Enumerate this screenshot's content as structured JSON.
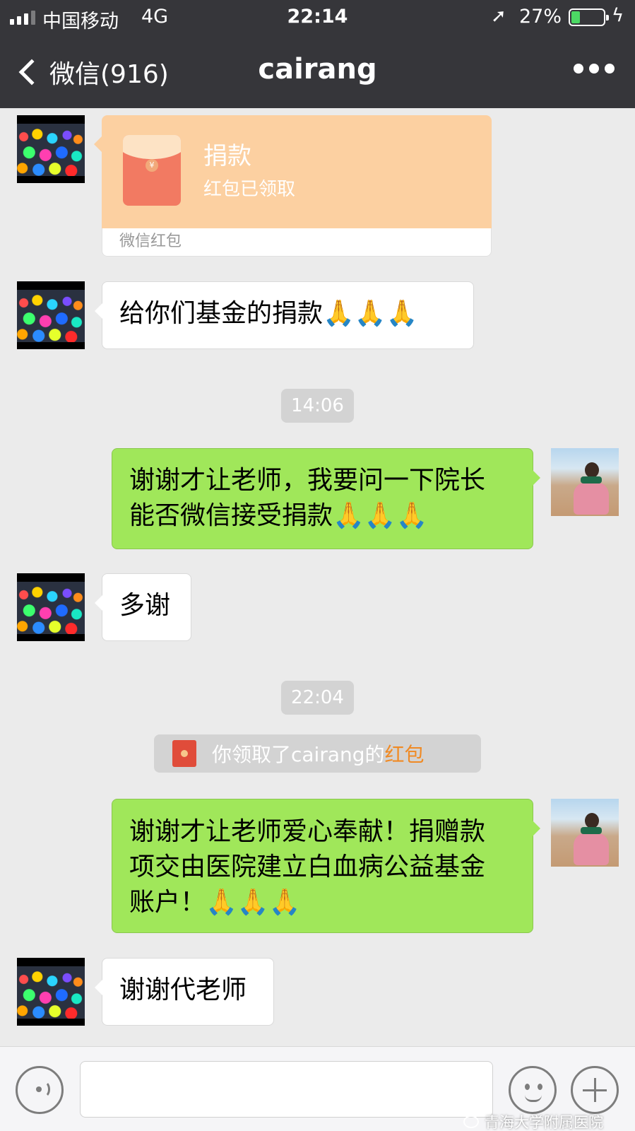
{
  "status_bar": {
    "carrier": "中国移动",
    "network": "4G",
    "time": "22:14",
    "location_icon": "➚",
    "battery_percent": "27%",
    "battery_level": 0.27,
    "charging_icon": "ϟ"
  },
  "nav": {
    "back_label": "微信(916)",
    "title": "cairang"
  },
  "messages": {
    "red_packet": {
      "title": "捐款",
      "status": "红包已领取",
      "footer": "微信红包",
      "coin_symbol": "¥"
    },
    "m1": "给你们基金的捐款🙏🙏🙏",
    "ts1": "14:06",
    "m2": "谢谢才让老师，我要问一下院长\n能否微信接受捐款🙏🙏🙏",
    "m3": "多谢",
    "ts2": "22:04",
    "system": {
      "prefix": "你领取了cairang的",
      "link": "红包"
    },
    "m4": "谢谢才让老师爱心奉献！捐赠款\n项交由医院建立白血病公益基金\n账户！🙏🙏🙏",
    "m5": "谢谢代老师"
  },
  "input_bar": {
    "input_value": ""
  },
  "watermark": "青海大学附属医院",
  "colors": {
    "nav_bg": "#36363a",
    "chat_bg": "#ebebeb",
    "green_bubble": "#a0e75a",
    "red_packet_bg": "#fcd0a1",
    "link_orange": "#f08a24"
  }
}
